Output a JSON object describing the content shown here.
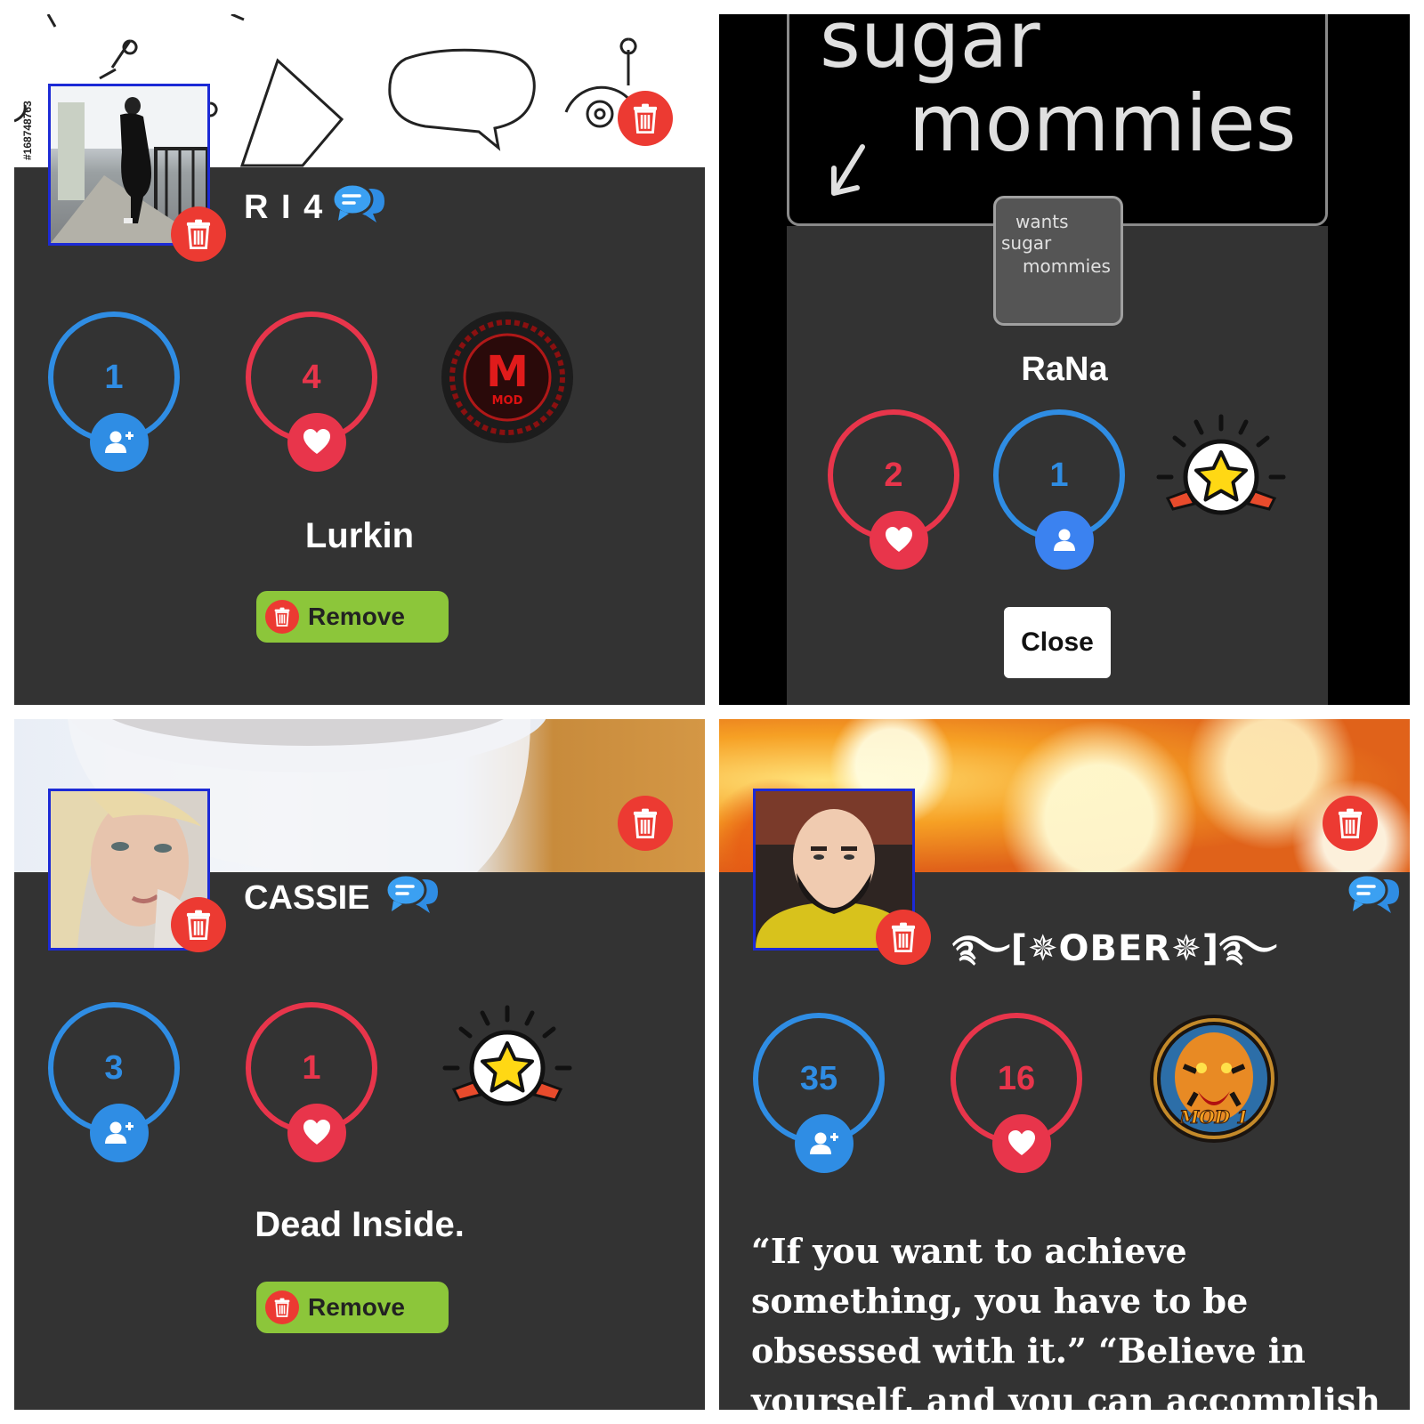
{
  "colors": {
    "blue": "#2f8de4",
    "red": "#e8354b",
    "green": "#8cc63a",
    "trash": "#ec3a32",
    "panel": "#333333"
  },
  "icons": [
    "trash-icon",
    "chat-icon",
    "add-user-icon",
    "heart-icon",
    "user-icon",
    "star-badge-icon",
    "mod-badge-icon"
  ],
  "panel1": {
    "cover_watermark": "#168748763",
    "username": "R I 4",
    "followers": "1",
    "likes": "4",
    "badge": "MOD",
    "status": "Lurkin",
    "remove_label": "Remove"
  },
  "panel2": {
    "bio_line1": "sugar",
    "bio_line2": "mommies",
    "thumb_line1": "wants",
    "thumb_line2": "sugar",
    "thumb_line3": "mommies",
    "name": "RaNa",
    "likes": "2",
    "followers": "1",
    "close_label": "Close"
  },
  "panel3": {
    "username": "CASSIE",
    "followers": "3",
    "likes": "1",
    "status": "Dead Inside.",
    "remove_label": "Remove"
  },
  "panel4": {
    "username": "࿐[✵OBER✵]࿐",
    "followers": "35",
    "likes": "16",
    "badge": "MOD 1",
    "quote": "“If you want to achieve something, you have to be obsessed with it.” “Believe in yourself, and you can accomplish anything.” “Your"
  }
}
